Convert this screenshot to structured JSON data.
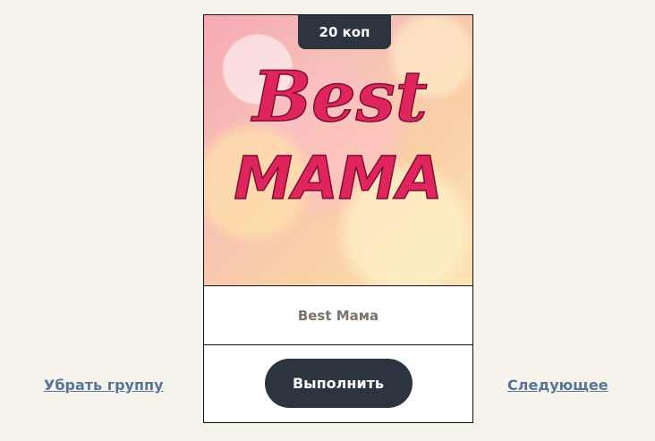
{
  "card": {
    "price": "20 коп",
    "image": {
      "word_top": "Best",
      "word_bottom": "MAMA",
      "text_color": "#e0245e"
    },
    "title": "Best Мама",
    "action_label": "Выполнить"
  },
  "links": {
    "remove_group": "Убрать группу",
    "next": "Следующее"
  },
  "colors": {
    "background": "#f5f3ec",
    "button": "#2c3440",
    "link": "#5a7398",
    "title": "#7b7368"
  }
}
